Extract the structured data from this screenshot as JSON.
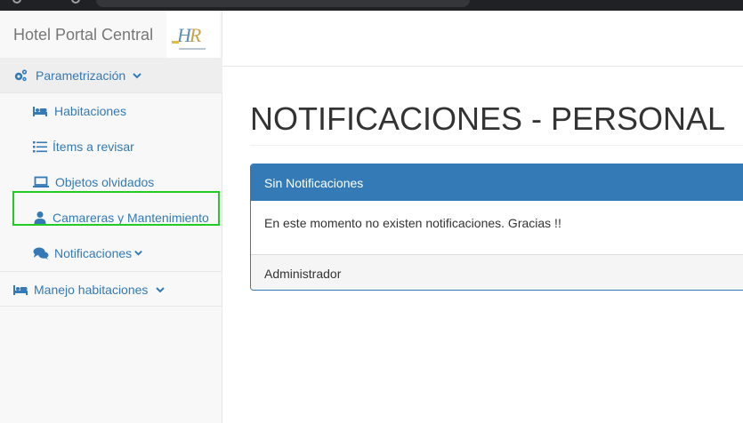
{
  "brand": {
    "title": "Hotel Portal Central",
    "logo_text": "HR"
  },
  "sidebar": {
    "sections": [
      {
        "label": "Parametrización",
        "icon": "cogs-icon",
        "expanded": true
      },
      {
        "label": "Manejo habitaciones",
        "icon": "bed-icon",
        "expanded": false
      }
    ],
    "items": [
      {
        "label": "Habitaciones",
        "icon": "bed-icon"
      },
      {
        "label": "Ítems a revisar",
        "icon": "list-icon"
      },
      {
        "label": "Objetos olvidados",
        "icon": "laptop-icon"
      },
      {
        "label": "Camareras y Mantenimiento",
        "icon": "user-icon"
      },
      {
        "label": "Notificaciones",
        "icon": "comments-icon"
      }
    ]
  },
  "main": {
    "title": "NOTIFICACIONES - PERSONAL",
    "panel": {
      "heading": "Sin Notificaciones",
      "body": "En este momento no existen notificaciones. Gracias !!",
      "footer": "Administrador"
    }
  },
  "colors": {
    "link": "#337ab7",
    "panel": "#337ab7",
    "highlight": "#22cc22"
  }
}
